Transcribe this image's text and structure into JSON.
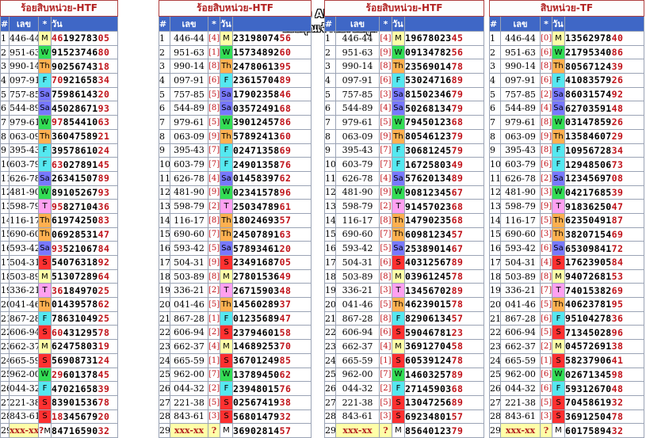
{
  "watermark": {
    "line1": "ห้องหวยของ APICHOKE.NET",
    "line2": "ขอบคุณเจ้าของข้อมูล"
  },
  "header": {
    "hash": "#",
    "lek": "เลข",
    "star": "*",
    "wan": "วัน"
  },
  "last_row": {
    "num": "xxx-xx",
    "q": "?"
  },
  "day_colors": {
    "M": "#ffffa8",
    "W": "#33dd55",
    "Th": "#ffb050",
    "F": "#55e8f0",
    "Sa": "#7878ff",
    "S": "#ff3030",
    "T": "#ffa0f0"
  },
  "numbers": [
    "446-44",
    "951-63",
    "990-14",
    "097-91",
    "757-85",
    "544-89",
    "979-61",
    "063-09",
    "395-43",
    "603-79",
    "626-78",
    "481-90",
    "598-79",
    "116-17",
    "690-60",
    "593-42",
    "504-31",
    "503-89",
    "336-21",
    "041-46",
    "867-28",
    "606-94",
    "662-37",
    "665-59",
    "962-00",
    "044-32",
    "221-38",
    "843-61"
  ],
  "days": [
    "M",
    "W",
    "Th",
    "F",
    "Sa",
    "Sa",
    "W",
    "Th",
    "F",
    "F",
    "Sa",
    "W",
    "T",
    "Th",
    "Th",
    "Sa",
    "S",
    "M",
    "T",
    "Th",
    "F",
    "S",
    "M",
    "S",
    "W",
    "F",
    "S",
    "S"
  ],
  "tables": [
    {
      "title": "ร้อยสิบหน่วย-HTF",
      "has_brackets": false,
      "last_day": "M",
      "brackets": [],
      "digits": [
        "4619278305",
        "9152374680",
        "9025674318",
        "7092165834",
        "7598614320",
        "4502867193",
        "9785441063",
        "3604758921",
        "3957861024",
        "6302789145",
        "2634150789",
        "8910526793",
        "9582710436",
        "6197425083",
        "0692853147",
        "9352106784",
        "5407631892",
        "5130728964",
        "3618497025",
        "0143957862",
        "7863104925",
        "6043129578",
        "6247580319",
        "5690873124",
        "2960137845",
        "4702165839",
        "8390153678",
        "1834567920"
      ],
      "last_digits": "8471659032"
    },
    {
      "title": "ร้อยสิบหน่วย-HTF",
      "has_brackets": true,
      "last_day": "M",
      "brackets": [
        "4",
        "1",
        "8",
        "6",
        "5",
        "8",
        "5",
        "9",
        "7",
        "7",
        "4",
        "9",
        "2",
        "8",
        "7",
        "5",
        "9",
        "8",
        "2",
        "5",
        "1",
        "2",
        "4",
        "1",
        "7",
        "2",
        "5",
        "3"
      ],
      "digits": [
        "2319807456",
        "1573489260",
        "2478061395",
        "2361570489",
        "1790235846",
        "0357249168",
        "3901245786",
        "5789241360",
        "0247135869",
        "2490135876",
        "0145839762",
        "0234157896",
        "2503478961",
        "1802469357",
        "2450789163",
        "5789346120",
        "2349168705",
        "2780153649",
        "2671590348",
        "1456028937",
        "0123568947",
        "2379460158",
        "1468925370",
        "3670124985",
        "1378945062",
        "2394801576",
        "0256741938",
        "5680147932"
      ],
      "last_digits": "3690281457"
    },
    {
      "title": "ร้อยสิบหน่วย-HTF",
      "has_brackets": true,
      "last_day": "M",
      "brackets": [
        "4",
        "9",
        "8",
        "6",
        "3",
        "4",
        "5",
        "9",
        "7",
        "7",
        "4",
        "9",
        "2",
        "8",
        "7",
        "5",
        "6",
        "8",
        "3",
        "5",
        "8",
        "6",
        "4",
        "1",
        "7",
        "2",
        "5",
        "3"
      ],
      "digits": [
        "1967802345",
        "0913478256",
        "2356901478",
        "5302471689",
        "8150234679",
        "5026813479",
        "7945012368",
        "8054612379",
        "3068124579",
        "1672580349",
        "5762013489",
        "9081234567",
        "9145702368",
        "1479023568",
        "6098123457",
        "2538901467",
        "4031256789",
        "0396124578",
        "1345670289",
        "4623901578",
        "8290613457",
        "5904678123",
        "3691270458",
        "6053912478",
        "1460325789",
        "2714590368",
        "1304725689",
        "6923480157",
        "8564012379"
      ],
      "last_digits": "8564012379"
    },
    {
      "title": "สิบหน่วย-TF",
      "has_brackets": true,
      "last_day": "M",
      "brackets": [
        "0",
        "6",
        "8",
        "6",
        "2",
        "4",
        "8",
        "9",
        "8",
        "6",
        "2",
        "3",
        "9",
        "5",
        "3",
        "6",
        "4",
        "8",
        "7",
        "5",
        "6",
        "5",
        "2",
        "1",
        "6",
        "6",
        "5",
        "3"
      ],
      "digits": [
        "1356297840",
        "2179534086",
        "8056712439",
        "4108357926",
        "8603157492",
        "6270359148",
        "0314785926",
        "1358460729",
        "1095672834",
        "1294850673",
        "1234569708",
        "0421768539",
        "9183625047",
        "6235049187",
        "3820715469",
        "6530984172",
        "1762390584",
        "9407268153",
        "7401538269",
        "4062378195",
        "9510427836",
        "7134502896",
        "0457269138",
        "5823790641",
        "0267134598",
        "5931267048",
        "7045861932",
        "3691250478",
        "6017589432"
      ],
      "last_digits": "6017589432"
    }
  ]
}
